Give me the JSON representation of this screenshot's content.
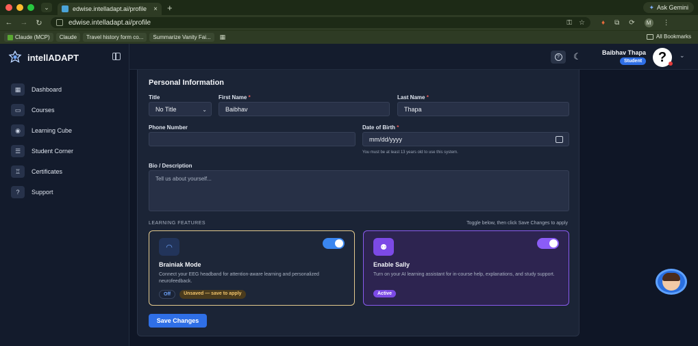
{
  "browser": {
    "tab_title": "edwise.intelladapt.ai/profile",
    "tab_close": "×",
    "new_tab": "+",
    "gemini_label": "Ask Gemini",
    "url": "edwise.intelladapt.ai/profile",
    "bookmarks": [
      "Claude (MCP)",
      "Claude",
      "Travel history form co...",
      "Summarize Vanity Fai..."
    ],
    "all_bookmarks": "All Bookmarks",
    "profile_initial": "M"
  },
  "sidebar": {
    "brand": "intellADAPT",
    "items": [
      {
        "label": "Dashboard",
        "icon": "dashboard-icon"
      },
      {
        "label": "Courses",
        "icon": "courses-icon"
      },
      {
        "label": "Learning Cube",
        "icon": "learning-cube-icon"
      },
      {
        "label": "Student Corner",
        "icon": "student-corner-icon"
      },
      {
        "label": "Certificates",
        "icon": "certificates-icon"
      },
      {
        "label": "Support",
        "icon": "support-icon"
      }
    ]
  },
  "header": {
    "user_name": "Baibhav Thapa",
    "role": "Student",
    "avatar_glyph": "?"
  },
  "form": {
    "section_title": "Personal Information",
    "title_label": "Title",
    "title_value": "No Title",
    "first_name_label": "First Name",
    "first_name_value": "Baibhav",
    "last_name_label": "Last Name",
    "last_name_value": "Thapa",
    "phone_label": "Phone Number",
    "phone_value": "",
    "dob_label": "Date of Birth",
    "dob_placeholder": "mm/dd/yyyy",
    "dob_hint": "You must be at least 13 years old to use this system.",
    "bio_label": "Bio / Description",
    "bio_placeholder": "Tell us about yourself...",
    "required_mark": "*"
  },
  "features": {
    "heading": "LEARNING FEATURES",
    "note": "Toggle below, then click Save Changes to apply",
    "brainiak": {
      "title": "Brainiak Mode",
      "description": "Connect your EEG headband for attention-aware learning and personalized neurofeedback.",
      "status": "Off",
      "unsaved": "Unsaved — save to apply",
      "toggle_on": true
    },
    "sally": {
      "title": "Enable Sally",
      "description": "Turn on your AI learning assistant for in-course help, explanations, and study support.",
      "status": "Active",
      "toggle_on": true
    }
  },
  "actions": {
    "save_label": "Save Changes"
  },
  "colors": {
    "primary": "#2f6fe6",
    "brainiak_border": "#e6cc8f",
    "sally_border": "#8a5cf0"
  }
}
